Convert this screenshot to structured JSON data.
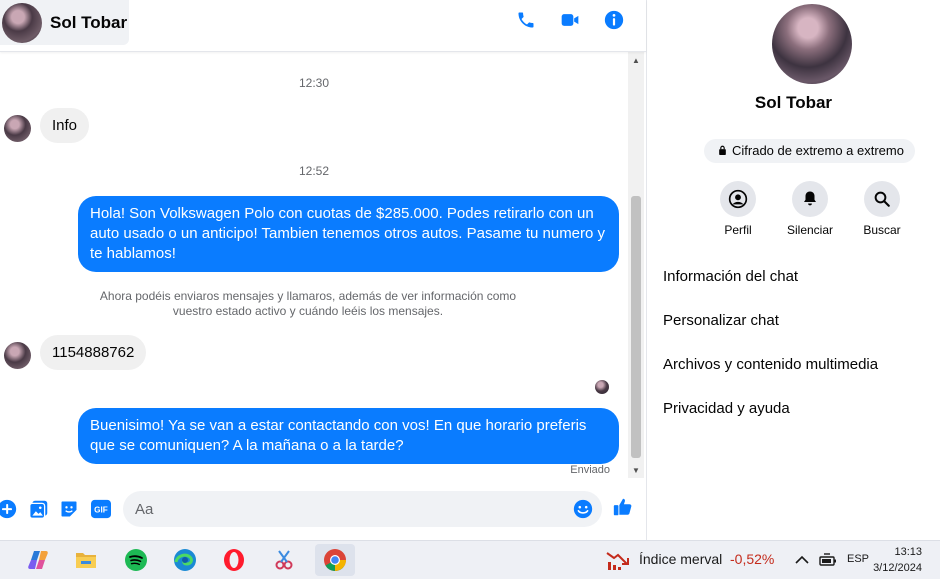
{
  "chat": {
    "contact_name": "Sol Tobar",
    "messages": {
      "time_1": "12:30",
      "incoming_1": "Info",
      "time_2": "12:52",
      "outgoing_1": "Hola! Son Volkswagen Polo con cuotas de $285.000. Podes retirarlo con un auto usado o un anticipo! Tambien tenemos otros autos. Pasame tu numero y te hablamos!",
      "notice": "Ahora podéis enviaros mensajes y llamaros, además de ver información como vuestro estado activo y cuándo leéis los mensajes.",
      "incoming_2": "1154888762",
      "outgoing_2": "Buenisimo! Ya se van a estar contactando con vos! En que horario preferis que se comuniquen? A la mañana o a la tarde?",
      "status": "Enviado"
    },
    "composer": {
      "placeholder": "Aa",
      "value": ""
    }
  },
  "info_panel": {
    "name": "Sol Tobar",
    "encryption_label": "Cifrado de extremo a extremo",
    "actions": [
      "Perfil",
      "Silenciar",
      "Buscar"
    ],
    "items": [
      "Información del chat",
      "Personalizar chat",
      "Archivos y contenido multimedia",
      "Privacidad y ayuda"
    ]
  },
  "taskbar": {
    "ticker_name": "Índice merval",
    "ticker_change": "-0,52%",
    "language": "ESP",
    "time": "13:13",
    "date": "3/12/2024"
  },
  "colors": {
    "accent": "#0a7cff",
    "bubble_in": "#f0f0f0",
    "ticker_negative": "#c42b1c"
  }
}
